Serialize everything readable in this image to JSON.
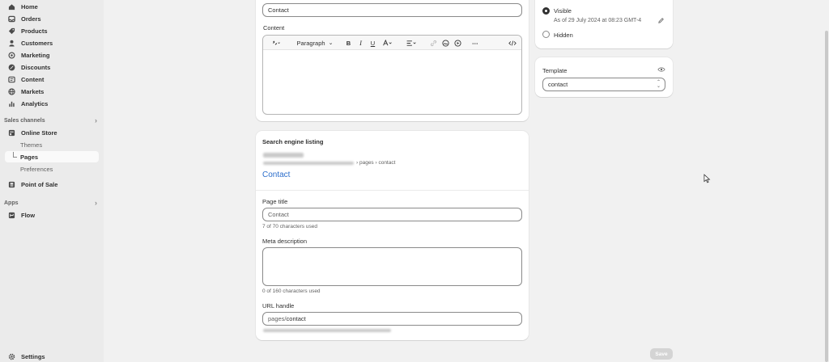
{
  "sidebar": {
    "items": [
      {
        "label": "Home",
        "icon": "home-icon"
      },
      {
        "label": "Orders",
        "icon": "inbox-icon"
      },
      {
        "label": "Products",
        "icon": "tag-icon"
      },
      {
        "label": "Customers",
        "icon": "person-icon"
      },
      {
        "label": "Marketing",
        "icon": "target-icon"
      },
      {
        "label": "Discounts",
        "icon": "discount-icon"
      },
      {
        "label": "Content",
        "icon": "content-icon"
      },
      {
        "label": "Markets",
        "icon": "globe-icon"
      },
      {
        "label": "Analytics",
        "icon": "bar-chart-icon"
      }
    ],
    "sales_channels_label": "Sales channels",
    "online_store": "Online Store",
    "themes": "Themes",
    "pages": "Pages",
    "preferences": "Preferences",
    "point_of_sale": "Point of Sale",
    "apps_label": "Apps",
    "flow": "Flow",
    "settings": "Settings"
  },
  "page_card": {
    "title_value": "Contact",
    "content_label": "Content",
    "toolbar": {
      "paragraph": "Paragraph",
      "more": "⋯"
    }
  },
  "seo": {
    "heading": "Search engine listing",
    "breadcrumb_suffix": "› pages › contact",
    "preview_title": "Contact",
    "page_title_label": "Page title",
    "page_title_placeholder": "Contact",
    "page_title_help": "7 of 70 characters used",
    "meta_label": "Meta description",
    "meta_help": "0 of 160 characters used",
    "url_label": "URL handle",
    "url_prefix": "pages/",
    "url_value": "contact"
  },
  "visibility": {
    "visible_label": "Visible",
    "visible_detail": "As of 29 July 2024 at 08:23 GMT-4",
    "hidden_label": "Hidden",
    "selected": "Visible"
  },
  "template": {
    "label": "Template",
    "value": "contact"
  },
  "save_label": "Save"
}
